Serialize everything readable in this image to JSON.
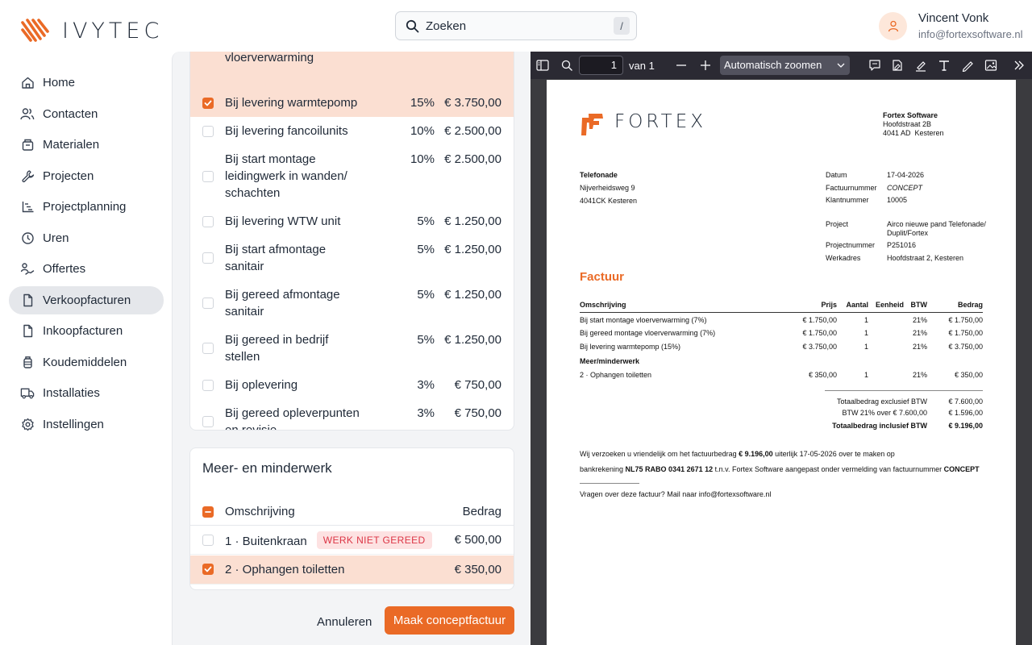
{
  "brand": {
    "name": "IVYTEC",
    "accent": "#ea6a26"
  },
  "search": {
    "placeholder": "Zoeken",
    "shortcut": "/"
  },
  "user": {
    "name": "Vincent Vonk",
    "email": "info@fortexsoftware.nl"
  },
  "sidebar": {
    "items": [
      {
        "label": "Home",
        "icon": "home-icon"
      },
      {
        "label": "Contacten",
        "icon": "users-icon"
      },
      {
        "label": "Materialen",
        "icon": "box-icon"
      },
      {
        "label": "Projecten",
        "icon": "wrench-icon"
      },
      {
        "label": "Projectplanning",
        "icon": "chart-icon"
      },
      {
        "label": "Uren",
        "icon": "clock-icon"
      },
      {
        "label": "Offertes",
        "icon": "offer-icon"
      },
      {
        "label": "Verkoopfacturen",
        "icon": "file-icon",
        "active": true
      },
      {
        "label": "Inkoopfacturen",
        "icon": "file-icon"
      },
      {
        "label": "Koudemiddelen",
        "icon": "cylinder-icon"
      },
      {
        "label": "Installaties",
        "icon": "truck-icon"
      },
      {
        "label": "Instellingen",
        "icon": "gear-icon"
      }
    ]
  },
  "terms": {
    "rows": [
      {
        "desc": "vloerverwarming",
        "pct": "",
        "amount": "",
        "checked": false,
        "selected": true
      },
      {
        "desc": "Bij levering warmtepomp",
        "pct": "15%",
        "amount": "€ 3.750,00",
        "checked": true,
        "selected": true
      },
      {
        "desc": "Bij levering fancoilunits",
        "pct": "10%",
        "amount": "€ 2.500,00",
        "checked": false
      },
      {
        "desc": "Bij start montage leidingwerk in wanden/ schachten",
        "pct": "10%",
        "amount": "€ 2.500,00",
        "checked": false
      },
      {
        "desc": "Bij levering WTW unit",
        "pct": "5%",
        "amount": "€ 1.250,00",
        "checked": false
      },
      {
        "desc": "Bij start afmontage sanitair",
        "pct": "5%",
        "amount": "€ 1.250,00",
        "checked": false
      },
      {
        "desc": "Bij gereed afmontage sanitair",
        "pct": "5%",
        "amount": "€ 1.250,00",
        "checked": false
      },
      {
        "desc": "Bij gereed in bedrijf stellen",
        "pct": "5%",
        "amount": "€ 1.250,00",
        "checked": false
      },
      {
        "desc": "Bij oplevering",
        "pct": "3%",
        "amount": "€ 750,00",
        "checked": false
      },
      {
        "desc": "Bij gereed opleverpunten en revisie",
        "pct": "3%",
        "amount": "€ 750,00",
        "checked": false
      }
    ]
  },
  "extra": {
    "title": "Meer- en minderwerk",
    "col_desc": "Omschrijving",
    "col_amount": "Bedrag",
    "rows": [
      {
        "desc": "1 · Buitenkraan",
        "badge": "WERK NIET GEREED",
        "amount": "€ 500,00",
        "checked": false
      },
      {
        "desc": "2 · Ophangen toiletten",
        "badge": "",
        "amount": "€ 350,00",
        "checked": true
      }
    ]
  },
  "actions": {
    "cancel": "Annuleren",
    "primary": "Maak conceptfactuur"
  },
  "pdf": {
    "page": "1",
    "of": "van 1",
    "zoom": "Automatisch zoomen",
    "company_logo": "FORTEX",
    "company": {
      "name": "Fortex Software",
      "street": "Hoofdstraat 2B",
      "city": "4041 AD  Kesteren"
    },
    "client": {
      "name": "Telefonade",
      "street": "Nijverheidsweg 9",
      "city": "4041CK Kesteren"
    },
    "meta": [
      {
        "label": "Datum",
        "value": "17-04-2026"
      },
      {
        "label": "Factuurnummer",
        "value": "CONCEPT"
      },
      {
        "label": "Klantnummer",
        "value": "10005"
      }
    ],
    "project": [
      {
        "label": "Project",
        "value": "Airco nieuwe pand Telefonade/",
        "value2": "Duplit/Fortex"
      },
      {
        "label": "Projectnummer",
        "value": "P251016"
      },
      {
        "label": "Werkadres",
        "value": "Hoofdstraat 2, Kesteren"
      }
    ],
    "title": "Factuur",
    "headers": {
      "desc": "Omschrijving",
      "price": "Prijs",
      "qty": "Aantal",
      "unit": "Eenheid",
      "vat": "BTW",
      "amount": "Bedrag"
    },
    "lines": [
      {
        "desc": "Bij start montage vloerverwarming (7%)",
        "price": "€ 1.750,00",
        "qty": "1",
        "vat": "21%",
        "amount": "€ 1.750,00"
      },
      {
        "desc": "Bij gereed montage vloerverwarming (7%)",
        "price": "€ 1.750,00",
        "qty": "1",
        "vat": "21%",
        "amount": "€ 1.750,00"
      },
      {
        "desc": "Bij levering warmtepomp (15%)",
        "price": "€ 3.750,00",
        "qty": "1",
        "vat": "21%",
        "amount": "€ 3.750,00"
      }
    ],
    "section": "Meer/minderwerk",
    "extra_lines": [
      {
        "desc": "2 · Ophangen toiletten",
        "price": "€ 350,00",
        "qty": "1",
        "vat": "21%",
        "amount": "€ 350,00"
      }
    ],
    "totals": [
      {
        "label": "Totaalbedrag exclusief BTW",
        "value": "€ 7.600,00"
      },
      {
        "label": "BTW 21% over € 7.600,00",
        "value": "€ 1.596,00"
      },
      {
        "label": "Totaalbedrag inclusief BTW",
        "value": "€ 9.196,00"
      }
    ],
    "note1_a": "Wij verzoeken u vriendelijk om het factuurbedrag ",
    "note1_b": "€ 9.196,00",
    "note1_c": " uiterlijk 17-05-2026 over te maken op",
    "note2_a": "bankrekening ",
    "note2_b": "NL75 RABO 0341 2671 12",
    "note2_c": " t.n.v. Fortex Software aangepast onder vermelding van factuurnummer ",
    "note2_d": "CONCEPT",
    "footer": "Vragen over deze factuur? Mail naar info@fortexsoftware.nl"
  }
}
